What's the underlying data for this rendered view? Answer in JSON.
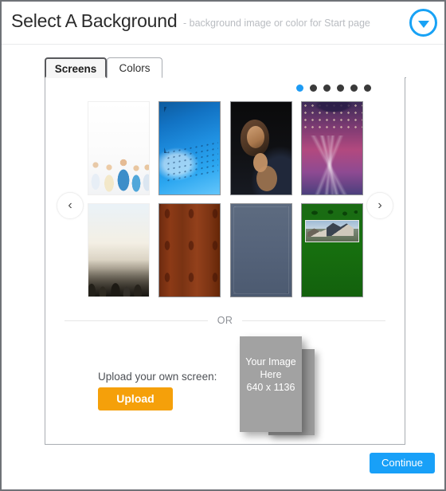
{
  "header": {
    "title": "Select A Background",
    "subtitle": "- background image or color for Start page",
    "toggle_icon": "circle-caret-down-icon"
  },
  "tabs": [
    {
      "label": "Screens",
      "active": true
    },
    {
      "label": "Colors",
      "active": false
    }
  ],
  "carousel": {
    "prev_icon": "chevron-left-icon",
    "next_icon": "chevron-right-icon",
    "dots": {
      "count": 6,
      "active_index": 0
    },
    "active_color": "#1d9bf4",
    "inactive_color": "#3a3a3a",
    "thumbnails": [
      {
        "name": "medical-team-screen",
        "art": "t-medical"
      },
      {
        "name": "blue-technology-screen",
        "art": "t-tech"
      },
      {
        "name": "fashion-portrait-screen",
        "art": "t-portrait"
      },
      {
        "name": "concert-stage-screen",
        "art": "t-concert"
      },
      {
        "name": "crowd-audience-screen",
        "art": "t-crowd"
      },
      {
        "name": "leather-texture-screen",
        "art": "t-leather"
      },
      {
        "name": "denim-texture-screen",
        "art": "t-denim"
      },
      {
        "name": "real-estate-house-screen",
        "art": "t-house"
      }
    ]
  },
  "divider": {
    "text": "OR"
  },
  "upload": {
    "label": "Upload your own screen:",
    "button_label": "Upload",
    "button_color": "#f5a00a",
    "placeholder_line1": "Your Image",
    "placeholder_line2": "Here",
    "placeholder_line3": "640 x 1136"
  },
  "footer": {
    "continue_label": "Continue",
    "continue_color": "#18a0f8"
  }
}
